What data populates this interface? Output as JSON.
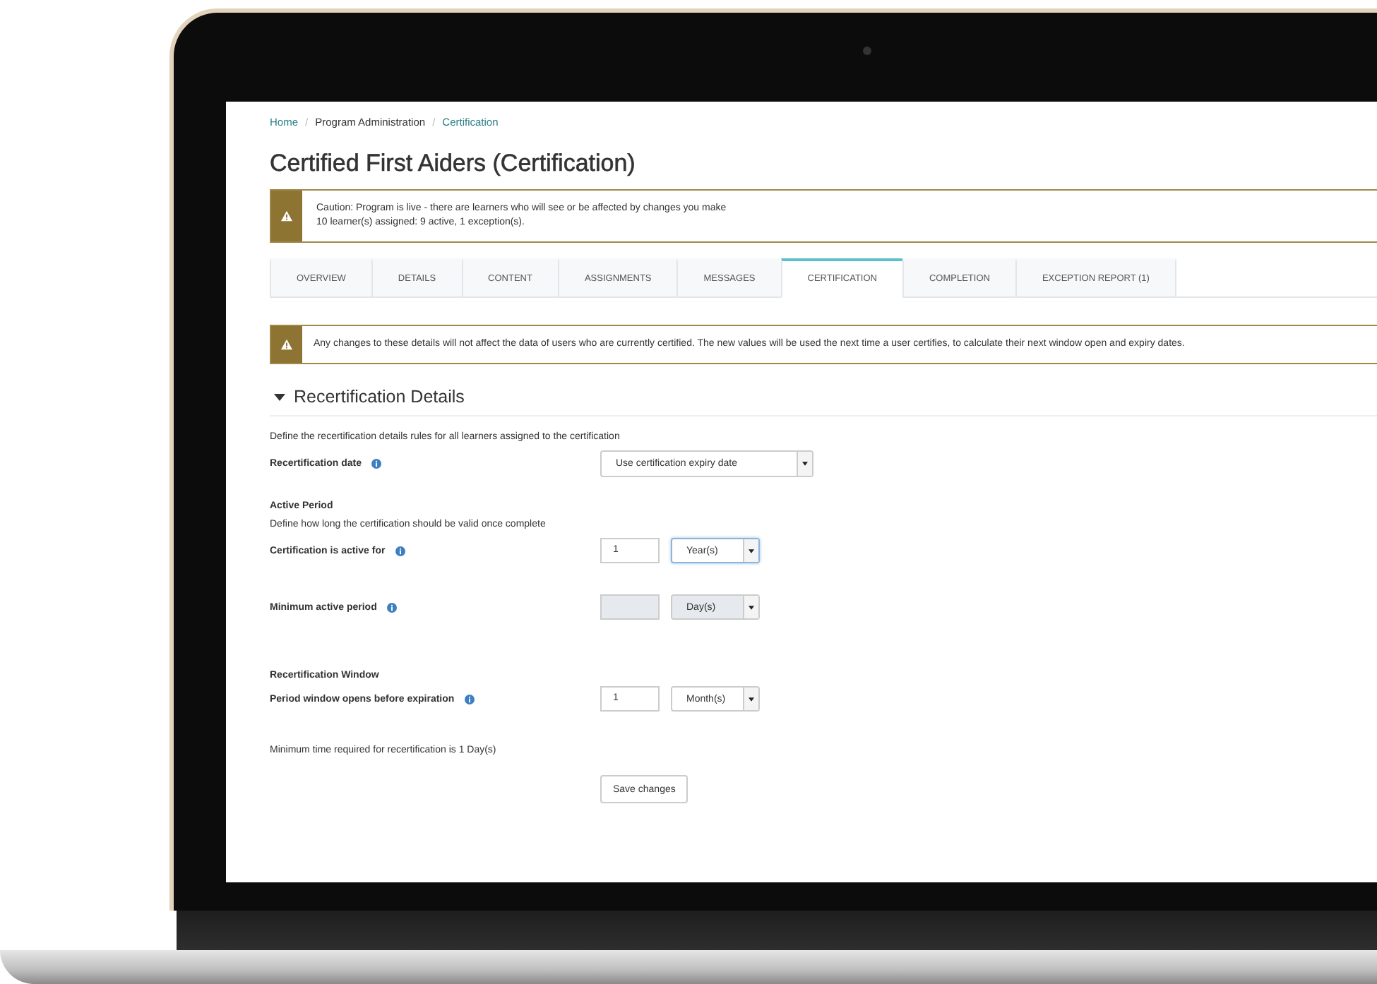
{
  "breadcrumb_separator": "/",
  "breadcrumb": [
    {
      "label": "Home",
      "link": true
    },
    {
      "label": "Program Administration",
      "link": false
    },
    {
      "label": "Certification",
      "link": true
    }
  ],
  "title": "Certified First Aiders (Certification)",
  "caution": {
    "lines": [
      "Caution: Program is live - there are learners who will see or be affected by changes you make",
      "10 learner(s) assigned: 9 active, 1 exception(s)."
    ]
  },
  "tabs": [
    {
      "label": "OVERVIEW",
      "selected": false
    },
    {
      "label": "DETAILS",
      "selected": false
    },
    {
      "label": "CONTENT",
      "selected": false
    },
    {
      "label": "ASSIGNMENTS",
      "selected": false
    },
    {
      "label": "MESSAGES",
      "selected": false
    },
    {
      "label": "CERTIFICATION",
      "selected": true
    },
    {
      "label": "COMPLETION",
      "selected": false
    },
    {
      "label": "EXCEPTION REPORT (1)",
      "selected": false
    }
  ],
  "notice": "Any changes to these details will not affect the data of users who are currently certified. The new values will be used the next time a user certifies, to calculate their next window open and expiry dates.",
  "section": {
    "title": "Recertification Details",
    "expanded": true
  },
  "form": [
    {
      "kind": "text",
      "text": "Define the recertification details rules for all learners assigned to the certification"
    },
    {
      "kind": "select",
      "label": "Recertification date",
      "value": "Use certification expiry date"
    },
    {
      "kind": "heading",
      "text": "Active Period"
    },
    {
      "kind": "text",
      "text": "Define how long the certification should be valid once complete"
    },
    {
      "kind": "period",
      "label": "Certification is active for",
      "number": "1",
      "unit": "Year(s)",
      "disabled": false,
      "focused": true
    },
    {
      "kind": "period",
      "label": "Minimum active period",
      "unit": "Day(s)",
      "disabled": true,
      "focused": false
    },
    {
      "kind": "heading",
      "text": "Recertification Window"
    },
    {
      "kind": "period",
      "label": "Period window opens before expiration",
      "number": "1",
      "unit": "Month(s)",
      "disabled": false,
      "focused": false
    },
    {
      "kind": "text",
      "text": "Minimum time required for recertification is 1 Day(s)"
    },
    {
      "kind": "button",
      "label": "Save changes"
    }
  ]
}
